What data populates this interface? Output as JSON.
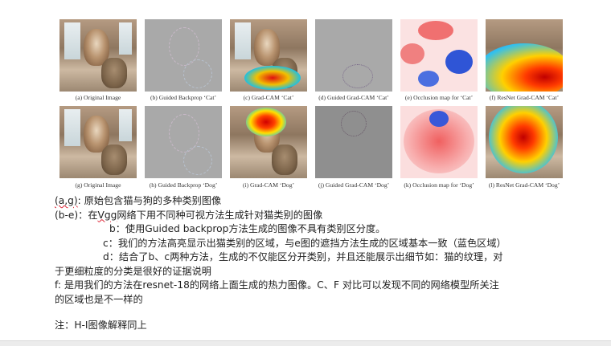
{
  "captions_row1": [
    "(a) Original Image",
    "(b) Guided Backprop ‘Cat’",
    "(c) Grad-CAM ‘Cat’",
    "(d) Guided Grad-CAM ‘Cat’",
    "(e) Occlusion map for ‘Cat’",
    "(f) ResNet Grad-CAM ‘Cat’"
  ],
  "captions_row2": [
    "(g) Original Image",
    "(h) Guided Backprop ‘Dog’",
    "(i) Grad-CAM ‘Dog’",
    "(j) Guided Grad-CAM ‘Dog’",
    "(k) Occlusion map for ‘Dog’",
    "(l) ResNet Grad-CAM ‘Dog’"
  ],
  "notes": {
    "line1_prefix": "(a,g)",
    "line1_rest": ": 原始包含猫与狗的多种类别图像",
    "line2_a": "(b-e)：在",
    "line2_vgg": "Vgg",
    "line2_b": "网络下用不同种可视方法生成针对猫类别的图像",
    "line3": "b：使用Guided backprop方法生成的图像不具有类别区分度。",
    "line4": "c：我们的方法高亮显示出猫类别的区域，与e图的遮挡方法生成的区域基本一致（蓝色区域）",
    "line5": "d：结合了b、c两种方法，生成的不仅能区分开类别，并且还能展示出细节如：猫的纹理，对",
    "line6": "于更细粒度的分类是很好的证据说明",
    "line7": "f: 是用我们的方法在resnet-18的网络上面生成的热力图像。C、F 对比可以发现不同的网络模型所关注",
    "line8": "的区域也是不一样的",
    "line9": "注：H-I图像解释同上"
  }
}
